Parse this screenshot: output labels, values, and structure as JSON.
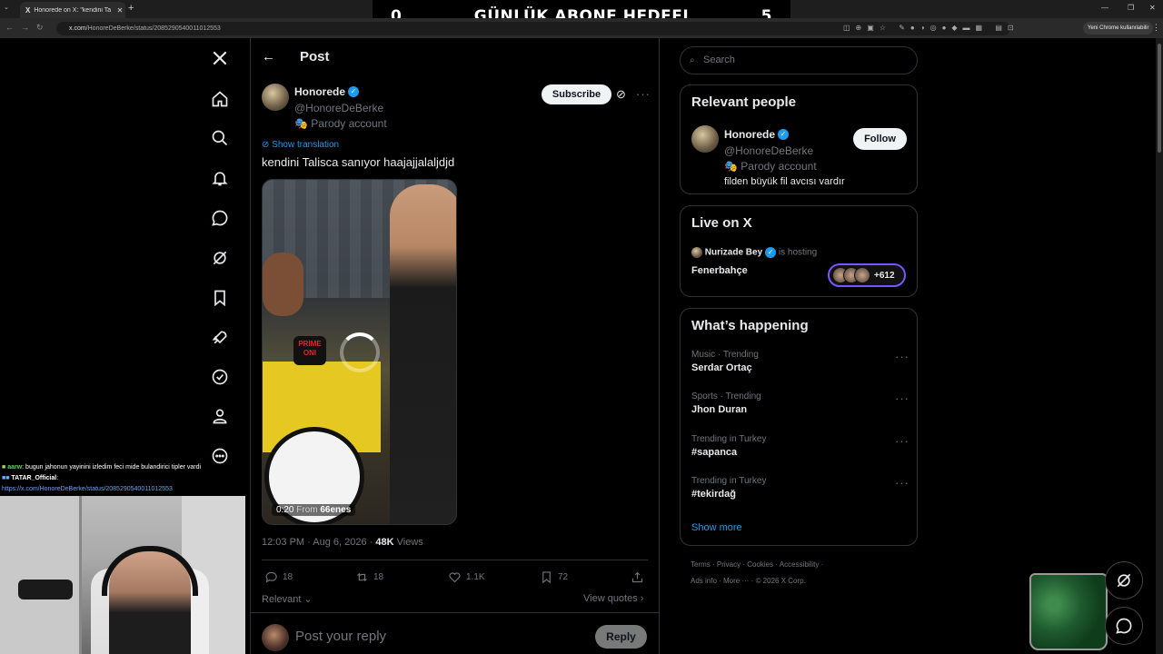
{
  "browser": {
    "tab_title": "Honorede on X: \"kendini Talisc",
    "tab_logo": "X",
    "url_host": "x.com",
    "url_path": "/HonoreDeBerke/status/2085290540011012553",
    "profile_chip": "Yeni Chrome kullanılabilir",
    "new_tab": "+"
  },
  "overlay": {
    "left_count": "0",
    "title": "GÜNLÜK ABONE HEDEFI",
    "right_count": "5"
  },
  "post": {
    "header_title": "Post",
    "author_name": "Honorede",
    "author_handle": "@HonoreDeBerke",
    "parody_label": "Parody account",
    "subscribe_label": "Subscribe",
    "translate_label": "Show translation",
    "text": "kendini Talisca sanıyor haajajjalaljdjd",
    "media_duration": "0:20",
    "media_from_label": "From",
    "media_from_user": "66enes",
    "media_mic_text": "PRIME ONI",
    "time": "12:03 PM · Aug 6, 2026 ·",
    "views_count": "48K",
    "views_label": "Views",
    "actions": {
      "replies": "18",
      "reposts": "18",
      "likes": "1.1K",
      "bookmarks": "72"
    },
    "sort_label": "Relevant",
    "view_quotes_label": "View quotes",
    "reply_placeholder": "Post your reply",
    "reply_button": "Reply"
  },
  "sidebar_right": {
    "search_placeholder": "Search",
    "relevant_people": {
      "title": "Relevant people",
      "name": "Honorede",
      "handle": "@HonoreDeBerke",
      "parody_label": "Parody account",
      "bio": "filden büyük fil avcısı vardır",
      "follow_label": "Follow"
    },
    "live": {
      "title": "Live on X",
      "host": "Nurizade Bey",
      "hosting_label": "is hosting",
      "space_title": "Fenerbahçe",
      "listeners": "+612"
    },
    "happening": {
      "title": "What’s happening",
      "trends": [
        {
          "meta": "Music · Trending",
          "name": "Serdar Ortaç"
        },
        {
          "meta": "Sports · Trending",
          "name": "Jhon Duran"
        },
        {
          "meta": "Trending in Turkey",
          "name": "#sapanca"
        },
        {
          "meta": "Trending in Turkey",
          "name": "#tekirdağ"
        }
      ],
      "show_more": "Show more"
    },
    "footer": {
      "line1": "Terms  ·  Privacy  ·  Cookies  ·  Accessibility  ·",
      "line2": "Ads info  ·  More ···  ·  © 2026 X Corp."
    }
  },
  "stream_chat": [
    {
      "user": "aarw",
      "text": ": bugun jahonun yayinini izledim feci mide bulandirici tipler vardi"
    },
    {
      "user": "TATAR_Official",
      "text": ":"
    },
    {
      "user": "",
      "text": "https://x.com/HonoreDeBerke/status/2085290540011012553"
    }
  ],
  "colors": {
    "accent": "#1d9bf0",
    "background": "#000000",
    "border": "#2f3336",
    "muted_text": "#71767b",
    "live_ring": "#7856ff"
  },
  "icons": [
    "x-logo-icon",
    "home-icon",
    "search-icon",
    "bell-icon",
    "message-icon",
    "grok-icon",
    "bookmark-icon",
    "rocket-icon",
    "verified-badge-icon",
    "profile-icon",
    "more-circle-icon",
    "back-arrow-icon",
    "reply-icon",
    "repost-icon",
    "like-icon",
    "bookmark-icon",
    "share-icon",
    "chevron-down-icon",
    "chevron-right-icon"
  ]
}
